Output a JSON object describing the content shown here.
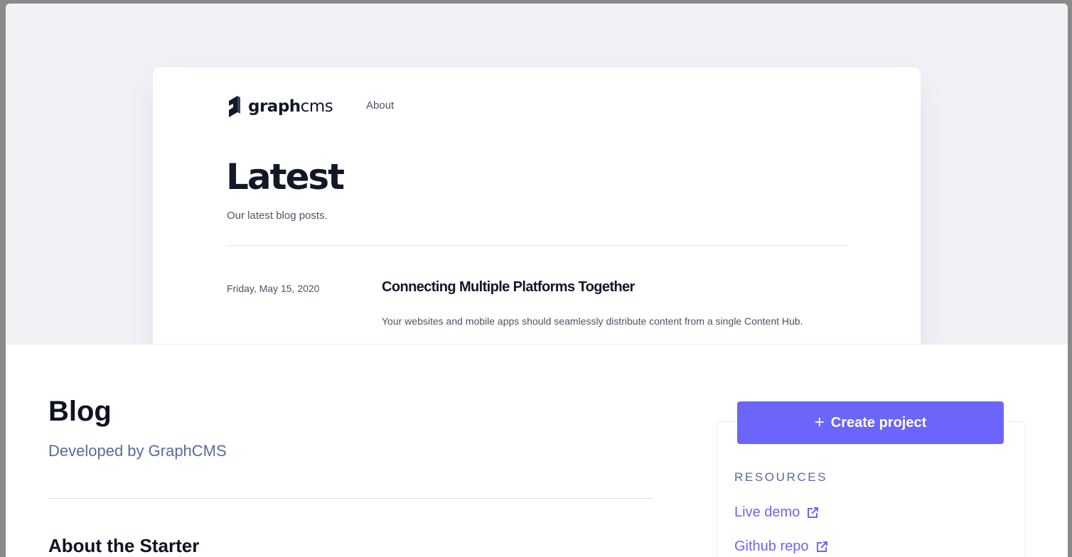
{
  "preview": {
    "logo_bold": "graph",
    "logo_light": "cms",
    "nav_about": "About",
    "title": "Latest",
    "subtitle": "Our latest blog posts.",
    "post": {
      "date": "Friday, May 15, 2020",
      "title": "Connecting Multiple Platforms Together",
      "excerpt": "Your websites and mobile apps should seamlessly distribute content from a single Content Hub."
    }
  },
  "starter": {
    "title": "Blog",
    "developer": "Developed by GraphCMS",
    "about_heading": "About the Starter"
  },
  "sidebar": {
    "create_button": "Create project",
    "resources_label": "RESOURCES",
    "links": [
      {
        "label": "Live demo",
        "icon": "external-link-icon"
      },
      {
        "label": "Github repo",
        "icon": "external-link-icon"
      }
    ]
  },
  "colors": {
    "accent": "#6b65fb",
    "preview_bg": "#f0f2f6",
    "muted_text": "#5b6b9a",
    "heading": "#0f1222"
  }
}
